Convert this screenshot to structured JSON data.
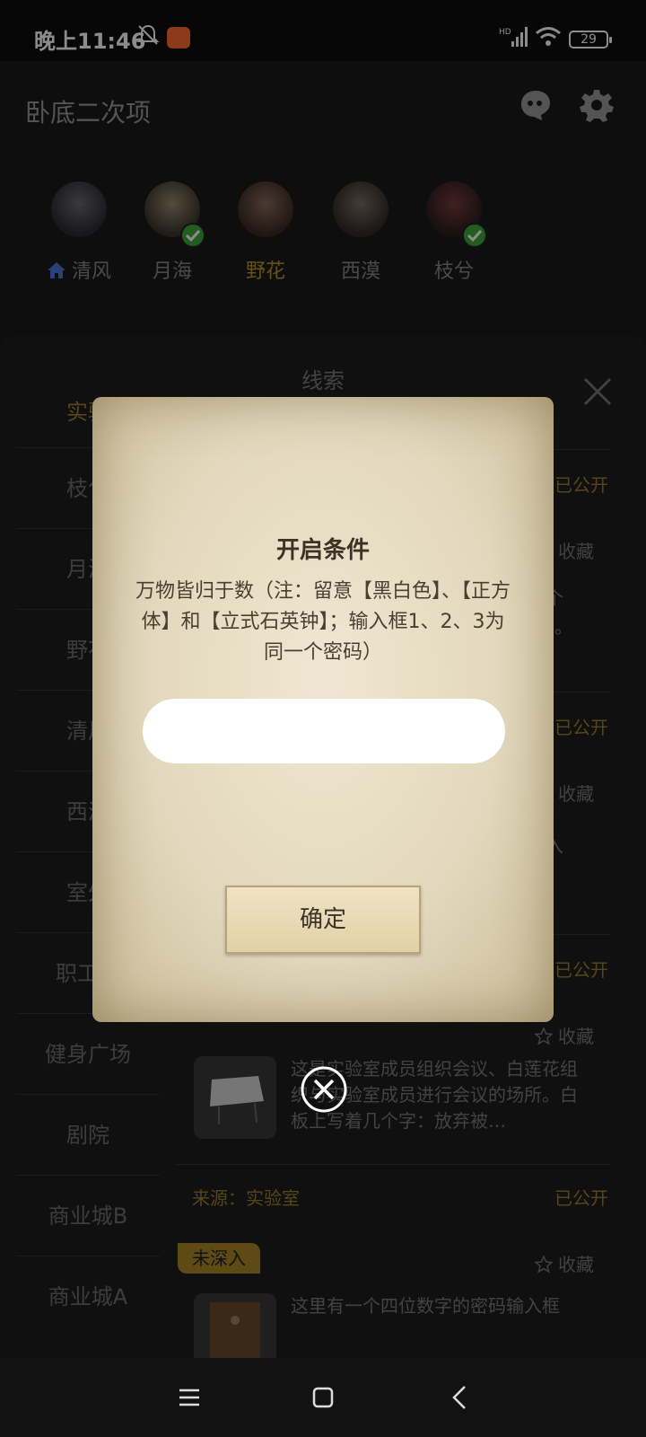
{
  "status_bar": {
    "time": "晚上11:46",
    "battery": "29"
  },
  "header": {
    "title": "卧底二次项"
  },
  "characters": [
    {
      "name": "清风",
      "home": true,
      "verified": false,
      "active": false
    },
    {
      "name": "月海",
      "home": false,
      "verified": true,
      "active": false
    },
    {
      "name": "野花",
      "home": false,
      "verified": false,
      "active": true
    },
    {
      "name": "西漠",
      "home": false,
      "verified": false,
      "active": false
    },
    {
      "name": "枝兮",
      "home": false,
      "verified": true,
      "active": false
    }
  ],
  "panel": {
    "title": "线索",
    "sidebar_items": [
      "实验",
      "枝兮",
      "月海",
      "野花",
      "清风",
      "西漠",
      "室外",
      "职工宿",
      "健身广场",
      "剧院",
      "商业城B",
      "商业城A"
    ],
    "status_public": "已公开",
    "favorite_label": "收藏",
    "partial_texts": [
      "个",
      "】。",
      "入"
    ],
    "card3_desc": "这是实验室成员组织会议、白莲花组织与实验室成员进行会议的场所。白板上写着几个字：放弃被…",
    "card3_source": "来源：实验室",
    "card4_tag": "未深入",
    "card4_desc": "这里有一个四位数字的密码输入框"
  },
  "dialog": {
    "title": "开启条件",
    "description": "万物皆归于数（注：留意【黑白色】、【正方体】和【立式石英钟】；输入框1、2、3为同一个密码）",
    "input_value": "",
    "input_placeholder": "",
    "confirm_label": "确定"
  },
  "colors": {
    "accent_gold": "#b8962e",
    "verified_green": "#3fa83a"
  }
}
